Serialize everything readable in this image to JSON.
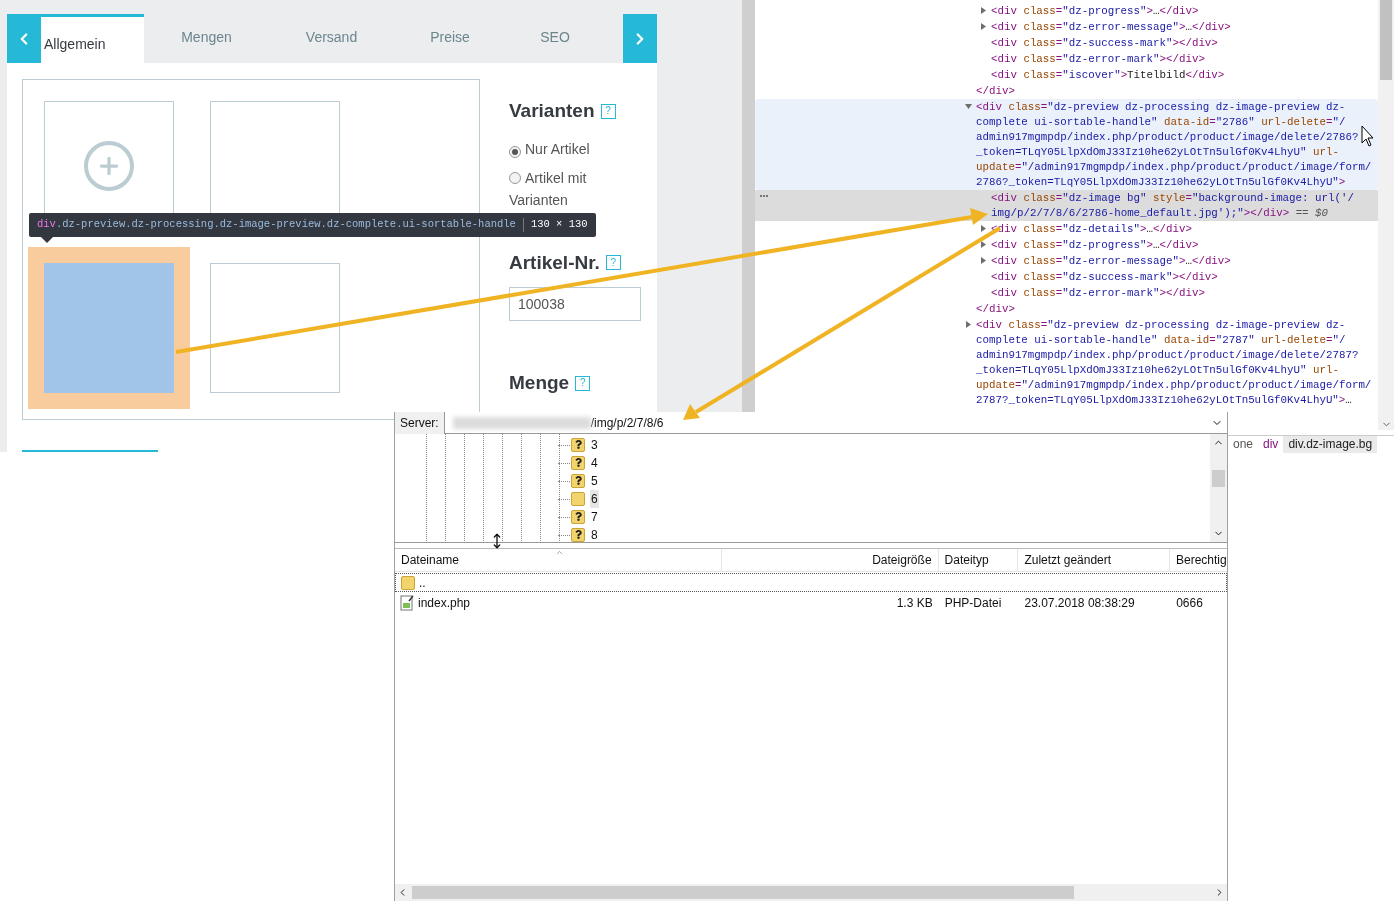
{
  "admin": {
    "tabs": [
      {
        "label": "Allgemein",
        "selected": true
      },
      {
        "label": "Mengen",
        "selected": false
      },
      {
        "label": "Versand",
        "selected": false
      },
      {
        "label": "Preise",
        "selected": false
      },
      {
        "label": "SEO",
        "selected": false
      }
    ],
    "tiles": [
      {
        "kind": "add"
      },
      {
        "kind": "cover"
      },
      {
        "kind": "highlighted"
      },
      {
        "kind": "empty"
      }
    ],
    "tooltip": {
      "tag": "div",
      "classes": ".dz-preview.dz-processing.dz-image-preview.dz-complete.ui-sortable-handle",
      "size": "130 × 130"
    },
    "variants": {
      "title": "Varianten",
      "help": "?",
      "options": [
        {
          "label": "Nur Artikel",
          "selected": true
        },
        {
          "label": "Artikel mit Varianten",
          "selected": false
        }
      ]
    },
    "article_number": {
      "title": "Artikel-Nr.",
      "help": "?",
      "value": "100038"
    },
    "quantity": {
      "title": "Menge",
      "help": "?"
    }
  },
  "devtools": {
    "dom": [
      {
        "closing": "</div>",
        "children": [
          {
            "text": "<div class=\"dz-progress\">…</div>",
            "expanded": false,
            "selected": false,
            "hovered": false
          },
          {
            "text": "<div class=\"dz-error-message\">…</div>",
            "expanded": false,
            "selected": false,
            "hovered": false
          },
          {
            "text": "<div class=\"dz-success-mark\"></div>",
            "selected": false,
            "hovered": false
          },
          {
            "text": "<div class=\"dz-error-mark\"></div>",
            "selected": false,
            "hovered": false
          },
          {
            "text": "<div class=\"iscover\">Titelbild</div>",
            "selected": false,
            "hovered": false
          }
        ]
      },
      {
        "text": "<div class=\"dz-preview dz-processing dz-image-preview dz-complete ui-sortable-handle\" data-id=\"2786\" url-delete=\"/admin917mgmpdp/index.php/product/product/image/delete/2786?_token=TLqY05LlpXdOmJ33Iz10he62yLOtTn5ulGf0Kv4LhyU\" url-update=\"/admin917mgmpdp/index.php/product/product/image/form/2786?_token=TLqY05LlpXdOmJ33Iz10he62yLOtTn5ulGf0Kv4LhyU\">",
        "expanded": true,
        "selected": false,
        "hovered": true,
        "closing": "</div>",
        "children": [
          {
            "text": "<div class=\"dz-image bg\" style=\"background-image: url('/img/p/2/7/8/6/2786-home_default.jpg');\"></div>",
            "suffix": " == $0",
            "selected": true,
            "hovered": false
          },
          {
            "text": "<div class=\"dz-details\">…</div>",
            "expanded": false,
            "selected": false,
            "hovered": false
          },
          {
            "text": "<div class=\"dz-progress\">…</div>",
            "expanded": false,
            "selected": false,
            "hovered": false
          },
          {
            "text": "<div class=\"dz-error-message\">…</div>",
            "expanded": false,
            "selected": false,
            "hovered": false
          },
          {
            "text": "<div class=\"dz-success-mark\"></div>",
            "selected": false,
            "hovered": false
          },
          {
            "text": "<div class=\"dz-error-mark\"></div>",
            "selected": false,
            "hovered": false
          }
        ]
      },
      {
        "text": "<div class=\"dz-preview dz-processing dz-image-preview dz-complete ui-sortable-handle\" data-id=\"2787\" url-delete=\"/admin917mgmpdp/index.php/product/product/image/delete/2787?_token=TLqY05LlpXdOmJ33Iz10he62yLOtTn5ulGf0Kv4LhyU\" url-update=\"/admin917mgmpdp/index.php/product/product/image/form/2787?_token=TLqY05LlpXdOmJ33Iz10he62yLOtTn5ulGf0Kv4LhyU\">…",
        "expanded": false,
        "selected": false,
        "hovered": false
      }
    ],
    "breadcrumb": [
      {
        "label": "one",
        "selected": false
      },
      {
        "label": "div",
        "selected": false
      },
      {
        "label": "div.dz-image.bg",
        "selected": true
      }
    ]
  },
  "ftp": {
    "server_label": "Server:",
    "path": "/img/p/2/7/8/6",
    "tree": [
      {
        "label": "3",
        "kind": "unknown",
        "selected": false
      },
      {
        "label": "4",
        "kind": "unknown",
        "selected": false
      },
      {
        "label": "5",
        "kind": "unknown",
        "selected": false
      },
      {
        "label": "6",
        "kind": "folder",
        "selected": true
      },
      {
        "label": "7",
        "kind": "unknown",
        "selected": false
      },
      {
        "label": "8",
        "kind": "unknown",
        "selected": false
      }
    ],
    "columns": [
      "Dateiname",
      "Dateigröße",
      "Dateityp",
      "Zuletzt geändert",
      "Berechtig"
    ],
    "files": [
      {
        "kind": "folder",
        "name": ".."
      },
      {
        "kind": "file",
        "name": "index.php",
        "size": "1.3 KB",
        "type": "PHP-Datei",
        "modified": "23.07.2018 08:38:29",
        "permissions": "0666"
      }
    ]
  }
}
